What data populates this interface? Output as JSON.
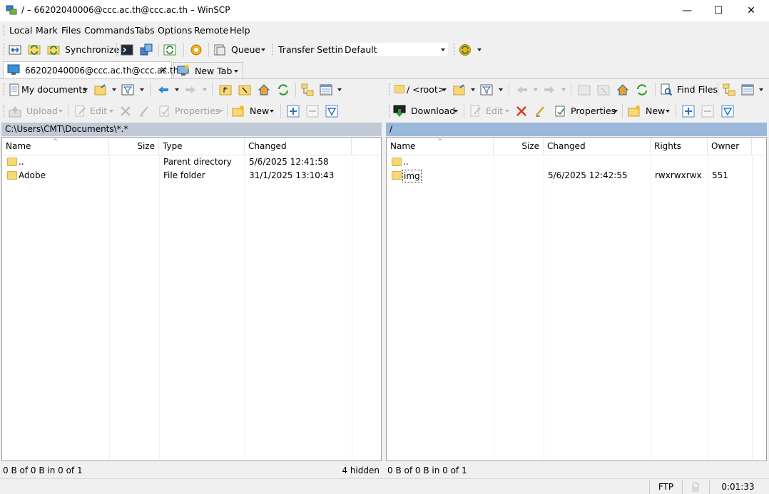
{
  "window": {
    "title": "/ – 66202040006@ccc.ac.th@ccc.ac.th – WinSCP",
    "minimize": "—",
    "maximize": "☐",
    "close": "✕"
  },
  "menu": [
    "Local",
    "Mark",
    "Files",
    "Commands",
    "Tabs",
    "Options",
    "Remote",
    "Help"
  ],
  "toolbar": {
    "synchronize": "Synchronize",
    "queue": "Queue",
    "transfer_settings": "Transfer Settings",
    "transfer_value": "Default"
  },
  "tabs": {
    "session": "66202040006@ccc.ac.th@ccc.ac.th",
    "close": "✕",
    "new_tab": "New Tab"
  },
  "left": {
    "location": "My documents",
    "upload": "Upload",
    "edit": "Edit",
    "properties": "Properties",
    "new": "New",
    "path": "C:\\Users\\CMT\\Documents\\*.*",
    "columns": [
      "Name",
      "Size",
      "Type",
      "Changed"
    ],
    "rows": [
      {
        "name": "..",
        "size": "",
        "type": "Parent directory",
        "changed": "5/6/2025 12:41:58"
      },
      {
        "name": "Adobe",
        "size": "",
        "type": "File folder",
        "changed": "31/1/2025 13:10:43"
      }
    ],
    "status": "0 B of 0 B in 0 of 1",
    "hidden": "4 hidden"
  },
  "right": {
    "location": "/ <root>",
    "find_files": "Find Files",
    "download": "Download",
    "edit": "Edit",
    "properties": "Properties",
    "new": "New",
    "path": "/",
    "columns": [
      "Name",
      "Size",
      "Changed",
      "Rights",
      "Owner"
    ],
    "rows": [
      {
        "name": "..",
        "size": "",
        "changed": "",
        "rights": "",
        "owner": ""
      },
      {
        "name": "img",
        "size": "",
        "changed": "5/6/2025 12:42:55",
        "rights": "rwxrwxrwx",
        "owner": "551"
      }
    ],
    "status": "0 B of 0 B in 0 of 1"
  },
  "bottom": {
    "protocol": "FTP",
    "elapsed": "0:01:33"
  },
  "colors": {
    "active_path": "#9bb8db",
    "inactive_path": "#c0cad6",
    "accent": "#0a64ad"
  }
}
